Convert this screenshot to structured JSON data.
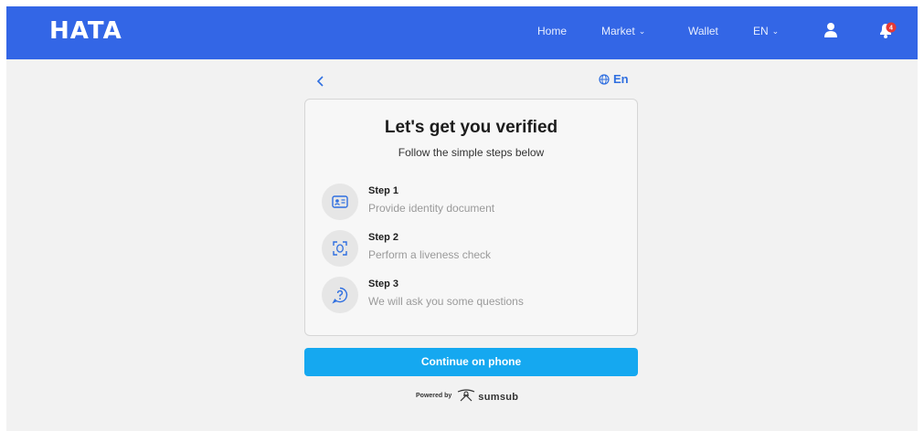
{
  "header": {
    "logo": "HATA",
    "nav": {
      "home": "Home",
      "market": "Market",
      "wallet": "Wallet",
      "language": "EN"
    },
    "notification_count": "4"
  },
  "verification": {
    "language": "En",
    "title": "Let's get you verified",
    "subtitle": "Follow the simple steps below",
    "steps": [
      {
        "label": "Step 1",
        "description": "Provide identity document",
        "icon": "id-card-icon"
      },
      {
        "label": "Step 2",
        "description": "Perform a liveness check",
        "icon": "face-scan-icon"
      },
      {
        "label": "Step 3",
        "description": "We will ask you some questions",
        "icon": "question-icon"
      }
    ],
    "continue_label": "Continue on phone",
    "powered_by": "Powered by",
    "provider": "sumsub"
  },
  "colors": {
    "header": "#3366e6",
    "accent": "#15a8f0",
    "link": "#2f6fe0",
    "badge": "#e53935"
  }
}
